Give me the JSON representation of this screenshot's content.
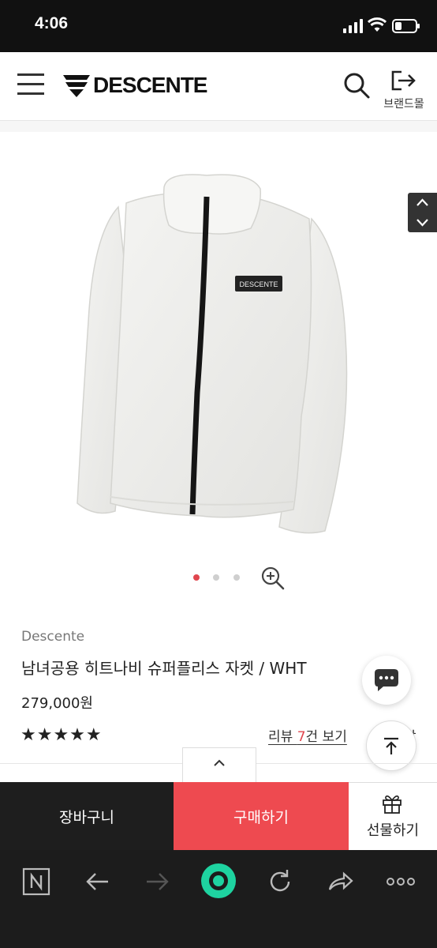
{
  "status": {
    "time": "4:06"
  },
  "header": {
    "logo": "DESCENTE",
    "brand_mall": "브랜드몰"
  },
  "product": {
    "brand": "Descente",
    "title": "남녀공용 히트나비 슈퍼플리스 자켓 / WHT",
    "price": "279,000원",
    "stars": "★★★★★",
    "rating": 5,
    "review_prefix": "리뷰 ",
    "review_count": "7",
    "review_suffix": "건 보기",
    "jacket_label": "DESCENTE",
    "partial_right_text": "상"
  },
  "gallery": {
    "total": 3,
    "active": 1
  },
  "actions": {
    "cart": "장바구니",
    "buy": "구매하기",
    "gift": "선물하기"
  },
  "colors": {
    "accent": "#ee4a50",
    "dark": "#1e1e1e",
    "status_bg": "#111111"
  }
}
